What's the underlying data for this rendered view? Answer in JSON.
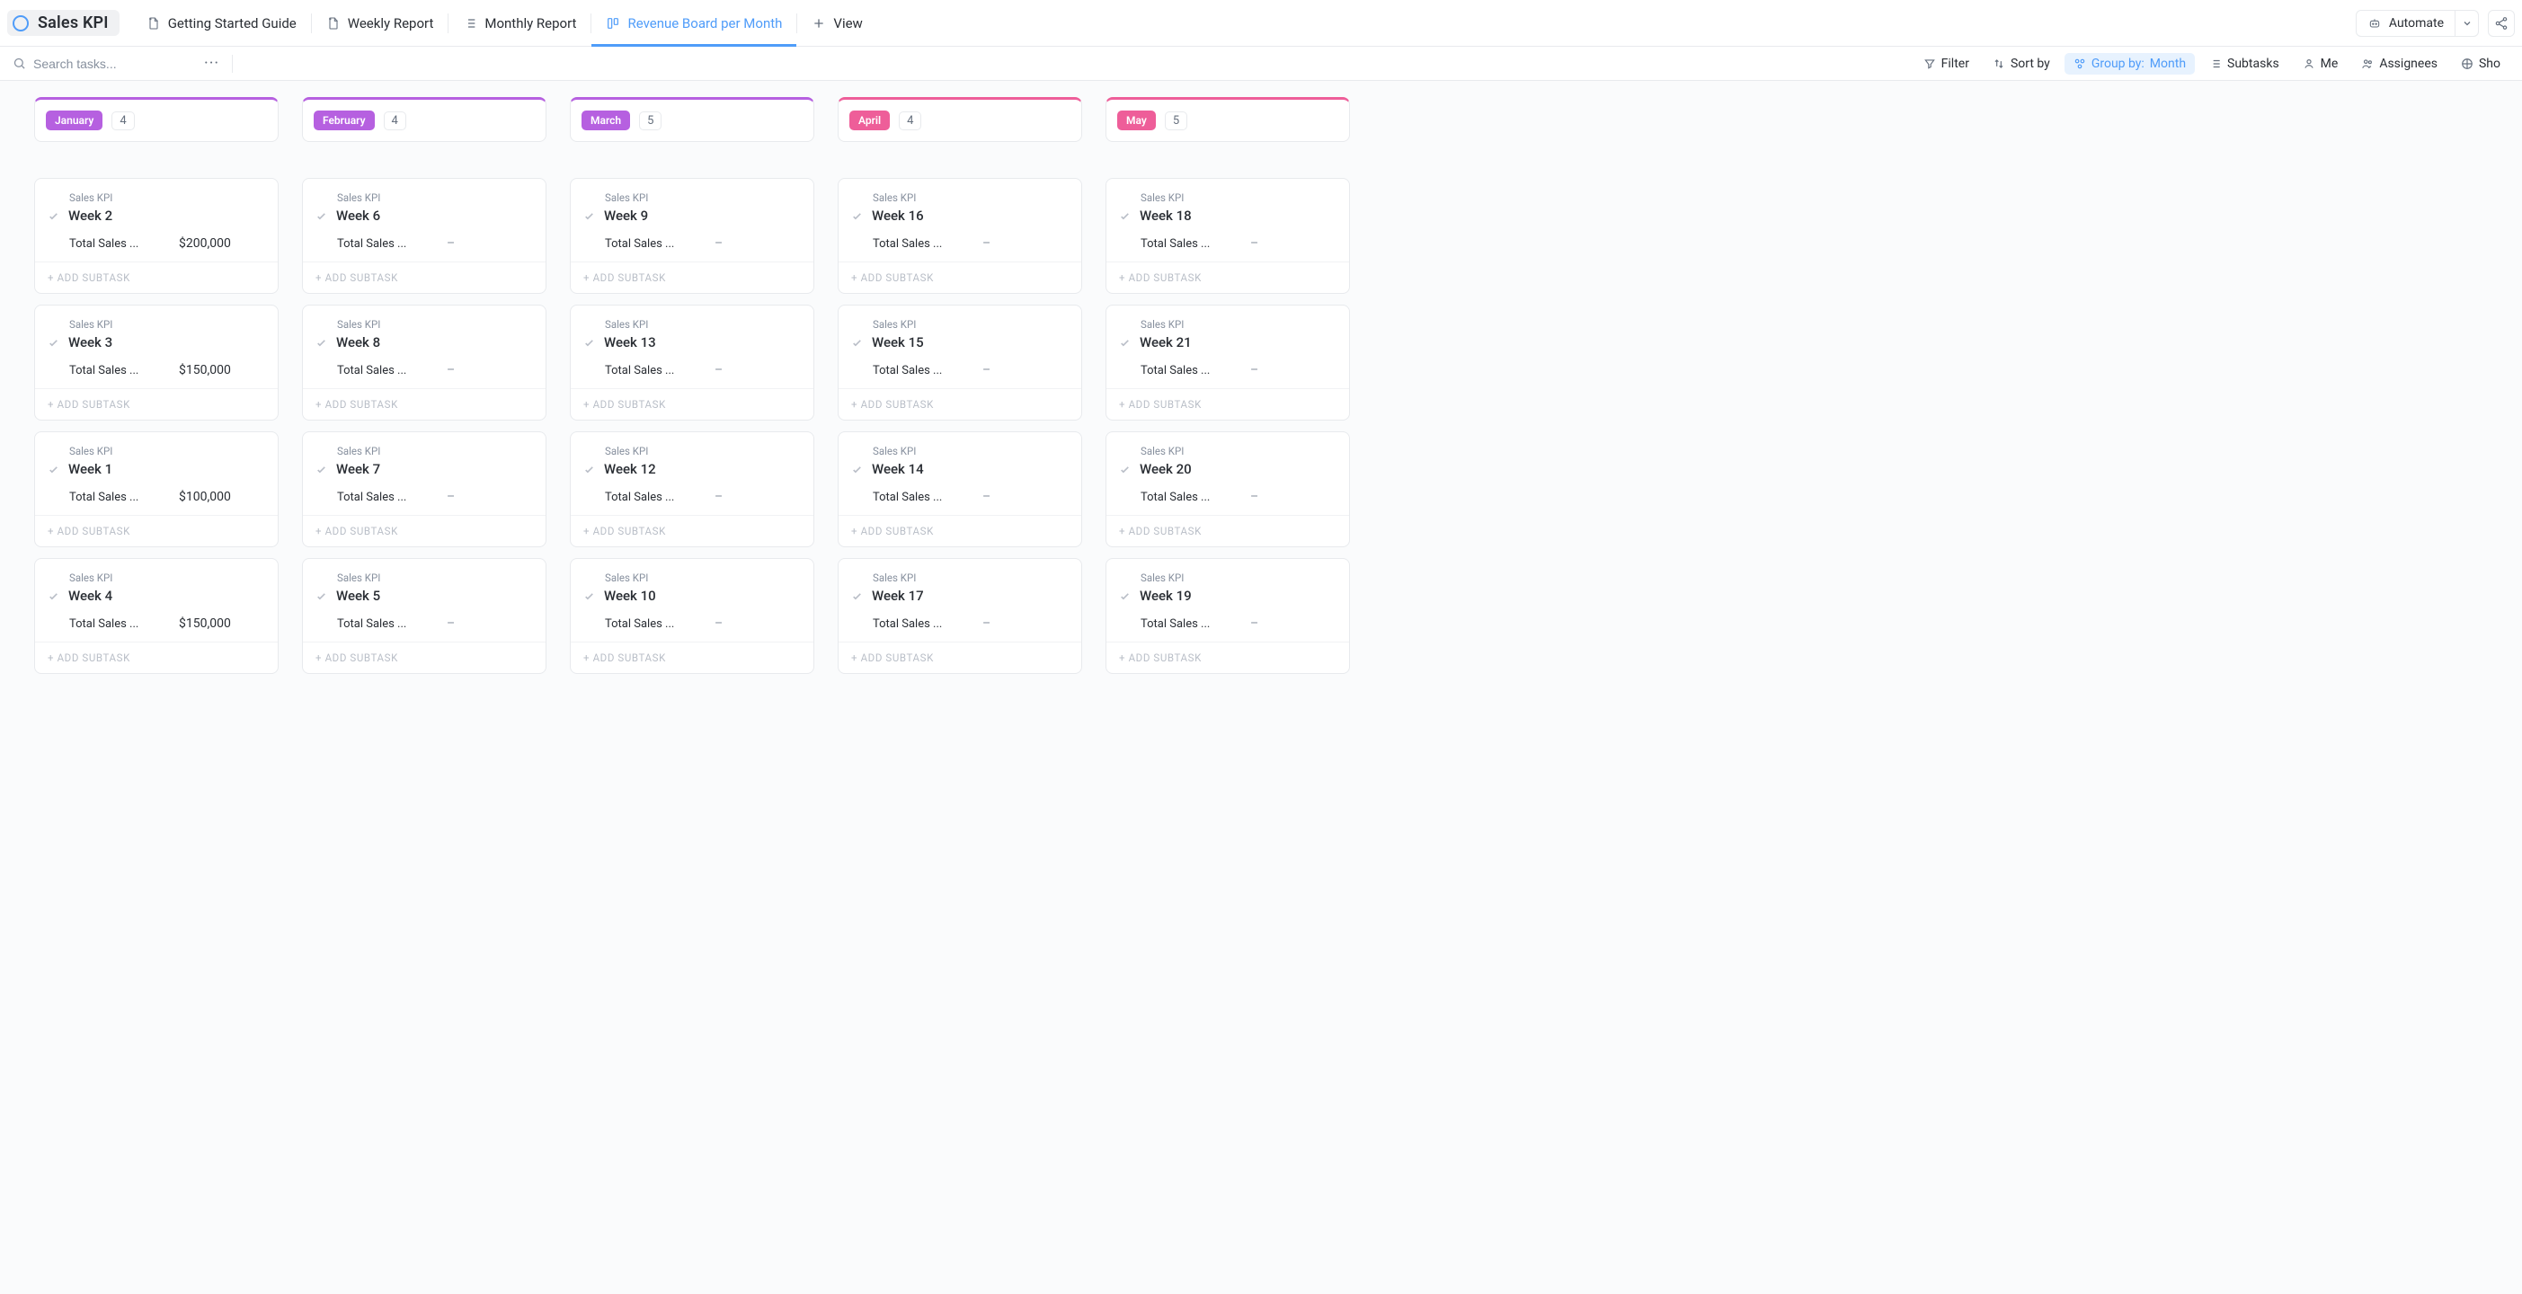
{
  "header": {
    "list_title": "Sales KPI",
    "tabs": [
      {
        "label": "Getting Started Guide",
        "icon": "page"
      },
      {
        "label": "Weekly Report",
        "icon": "page"
      },
      {
        "label": "Monthly Report",
        "icon": "list"
      },
      {
        "label": "Revenue Board per Month",
        "icon": "board",
        "active": true
      }
    ],
    "add_view": "View",
    "automate": "Automate"
  },
  "toolbar": {
    "search_placeholder": "Search tasks...",
    "filter": "Filter",
    "sortby": "Sort by",
    "groupby_label": "Group by:",
    "groupby_value": "Month",
    "subtasks": "Subtasks",
    "me": "Me",
    "assignees": "Assignees",
    "show": "Sho"
  },
  "common": {
    "project_label": "Sales KPI",
    "field_name": "Total Sales ...",
    "add_subtask": "+ ADD SUBTASK",
    "empty_value": "–"
  },
  "columns": [
    {
      "name": "January",
      "count": "4",
      "accent": "#b660e0",
      "cards": [
        {
          "title": "Week 2",
          "value": "$200,000"
        },
        {
          "title": "Week 3",
          "value": "$150,000"
        },
        {
          "title": "Week 1",
          "value": "$100,000"
        },
        {
          "title": "Week 4",
          "value": "$150,000"
        }
      ]
    },
    {
      "name": "February",
      "count": "4",
      "accent": "#b660e0",
      "cards": [
        {
          "title": "Week 6",
          "value": ""
        },
        {
          "title": "Week 8",
          "value": ""
        },
        {
          "title": "Week 7",
          "value": ""
        },
        {
          "title": "Week 5",
          "value": ""
        }
      ]
    },
    {
      "name": "March",
      "count": "5",
      "accent": "#b660e0",
      "cards": [
        {
          "title": "Week 9",
          "value": ""
        },
        {
          "title": "Week 13",
          "value": ""
        },
        {
          "title": "Week 12",
          "value": ""
        },
        {
          "title": "Week 10",
          "value": ""
        }
      ]
    },
    {
      "name": "April",
      "count": "4",
      "accent": "#ee5e99",
      "cards": [
        {
          "title": "Week 16",
          "value": ""
        },
        {
          "title": "Week 15",
          "value": ""
        },
        {
          "title": "Week 14",
          "value": ""
        },
        {
          "title": "Week 17",
          "value": ""
        }
      ]
    },
    {
      "name": "May",
      "count": "5",
      "accent": "#ee5e99",
      "cards": [
        {
          "title": "Week 18",
          "value": ""
        },
        {
          "title": "Week 21",
          "value": ""
        },
        {
          "title": "Week 20",
          "value": ""
        },
        {
          "title": "Week 19",
          "value": ""
        }
      ]
    }
  ]
}
